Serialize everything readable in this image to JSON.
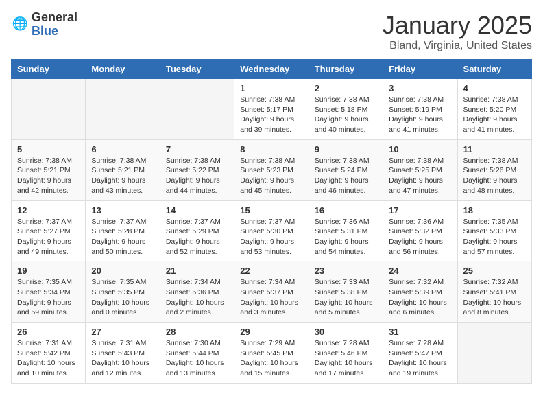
{
  "logo": {
    "general": "General",
    "blue": "Blue"
  },
  "header": {
    "month": "January 2025",
    "location": "Bland, Virginia, United States"
  },
  "weekdays": [
    "Sunday",
    "Monday",
    "Tuesday",
    "Wednesday",
    "Thursday",
    "Friday",
    "Saturday"
  ],
  "weeks": [
    [
      {
        "day": "",
        "info": ""
      },
      {
        "day": "",
        "info": ""
      },
      {
        "day": "",
        "info": ""
      },
      {
        "day": "1",
        "info": "Sunrise: 7:38 AM\nSunset: 5:17 PM\nDaylight: 9 hours\nand 39 minutes."
      },
      {
        "day": "2",
        "info": "Sunrise: 7:38 AM\nSunset: 5:18 PM\nDaylight: 9 hours\nand 40 minutes."
      },
      {
        "day": "3",
        "info": "Sunrise: 7:38 AM\nSunset: 5:19 PM\nDaylight: 9 hours\nand 41 minutes."
      },
      {
        "day": "4",
        "info": "Sunrise: 7:38 AM\nSunset: 5:20 PM\nDaylight: 9 hours\nand 41 minutes."
      }
    ],
    [
      {
        "day": "5",
        "info": "Sunrise: 7:38 AM\nSunset: 5:21 PM\nDaylight: 9 hours\nand 42 minutes."
      },
      {
        "day": "6",
        "info": "Sunrise: 7:38 AM\nSunset: 5:21 PM\nDaylight: 9 hours\nand 43 minutes."
      },
      {
        "day": "7",
        "info": "Sunrise: 7:38 AM\nSunset: 5:22 PM\nDaylight: 9 hours\nand 44 minutes."
      },
      {
        "day": "8",
        "info": "Sunrise: 7:38 AM\nSunset: 5:23 PM\nDaylight: 9 hours\nand 45 minutes."
      },
      {
        "day": "9",
        "info": "Sunrise: 7:38 AM\nSunset: 5:24 PM\nDaylight: 9 hours\nand 46 minutes."
      },
      {
        "day": "10",
        "info": "Sunrise: 7:38 AM\nSunset: 5:25 PM\nDaylight: 9 hours\nand 47 minutes."
      },
      {
        "day": "11",
        "info": "Sunrise: 7:38 AM\nSunset: 5:26 PM\nDaylight: 9 hours\nand 48 minutes."
      }
    ],
    [
      {
        "day": "12",
        "info": "Sunrise: 7:37 AM\nSunset: 5:27 PM\nDaylight: 9 hours\nand 49 minutes."
      },
      {
        "day": "13",
        "info": "Sunrise: 7:37 AM\nSunset: 5:28 PM\nDaylight: 9 hours\nand 50 minutes."
      },
      {
        "day": "14",
        "info": "Sunrise: 7:37 AM\nSunset: 5:29 PM\nDaylight: 9 hours\nand 52 minutes."
      },
      {
        "day": "15",
        "info": "Sunrise: 7:37 AM\nSunset: 5:30 PM\nDaylight: 9 hours\nand 53 minutes."
      },
      {
        "day": "16",
        "info": "Sunrise: 7:36 AM\nSunset: 5:31 PM\nDaylight: 9 hours\nand 54 minutes."
      },
      {
        "day": "17",
        "info": "Sunrise: 7:36 AM\nSunset: 5:32 PM\nDaylight: 9 hours\nand 56 minutes."
      },
      {
        "day": "18",
        "info": "Sunrise: 7:35 AM\nSunset: 5:33 PM\nDaylight: 9 hours\nand 57 minutes."
      }
    ],
    [
      {
        "day": "19",
        "info": "Sunrise: 7:35 AM\nSunset: 5:34 PM\nDaylight: 9 hours\nand 59 minutes."
      },
      {
        "day": "20",
        "info": "Sunrise: 7:35 AM\nSunset: 5:35 PM\nDaylight: 10 hours\nand 0 minutes."
      },
      {
        "day": "21",
        "info": "Sunrise: 7:34 AM\nSunset: 5:36 PM\nDaylight: 10 hours\nand 2 minutes."
      },
      {
        "day": "22",
        "info": "Sunrise: 7:34 AM\nSunset: 5:37 PM\nDaylight: 10 hours\nand 3 minutes."
      },
      {
        "day": "23",
        "info": "Sunrise: 7:33 AM\nSunset: 5:38 PM\nDaylight: 10 hours\nand 5 minutes."
      },
      {
        "day": "24",
        "info": "Sunrise: 7:32 AM\nSunset: 5:39 PM\nDaylight: 10 hours\nand 6 minutes."
      },
      {
        "day": "25",
        "info": "Sunrise: 7:32 AM\nSunset: 5:41 PM\nDaylight: 10 hours\nand 8 minutes."
      }
    ],
    [
      {
        "day": "26",
        "info": "Sunrise: 7:31 AM\nSunset: 5:42 PM\nDaylight: 10 hours\nand 10 minutes."
      },
      {
        "day": "27",
        "info": "Sunrise: 7:31 AM\nSunset: 5:43 PM\nDaylight: 10 hours\nand 12 minutes."
      },
      {
        "day": "28",
        "info": "Sunrise: 7:30 AM\nSunset: 5:44 PM\nDaylight: 10 hours\nand 13 minutes."
      },
      {
        "day": "29",
        "info": "Sunrise: 7:29 AM\nSunset: 5:45 PM\nDaylight: 10 hours\nand 15 minutes."
      },
      {
        "day": "30",
        "info": "Sunrise: 7:28 AM\nSunset: 5:46 PM\nDaylight: 10 hours\nand 17 minutes."
      },
      {
        "day": "31",
        "info": "Sunrise: 7:28 AM\nSunset: 5:47 PM\nDaylight: 10 hours\nand 19 minutes."
      },
      {
        "day": "",
        "info": ""
      }
    ]
  ]
}
